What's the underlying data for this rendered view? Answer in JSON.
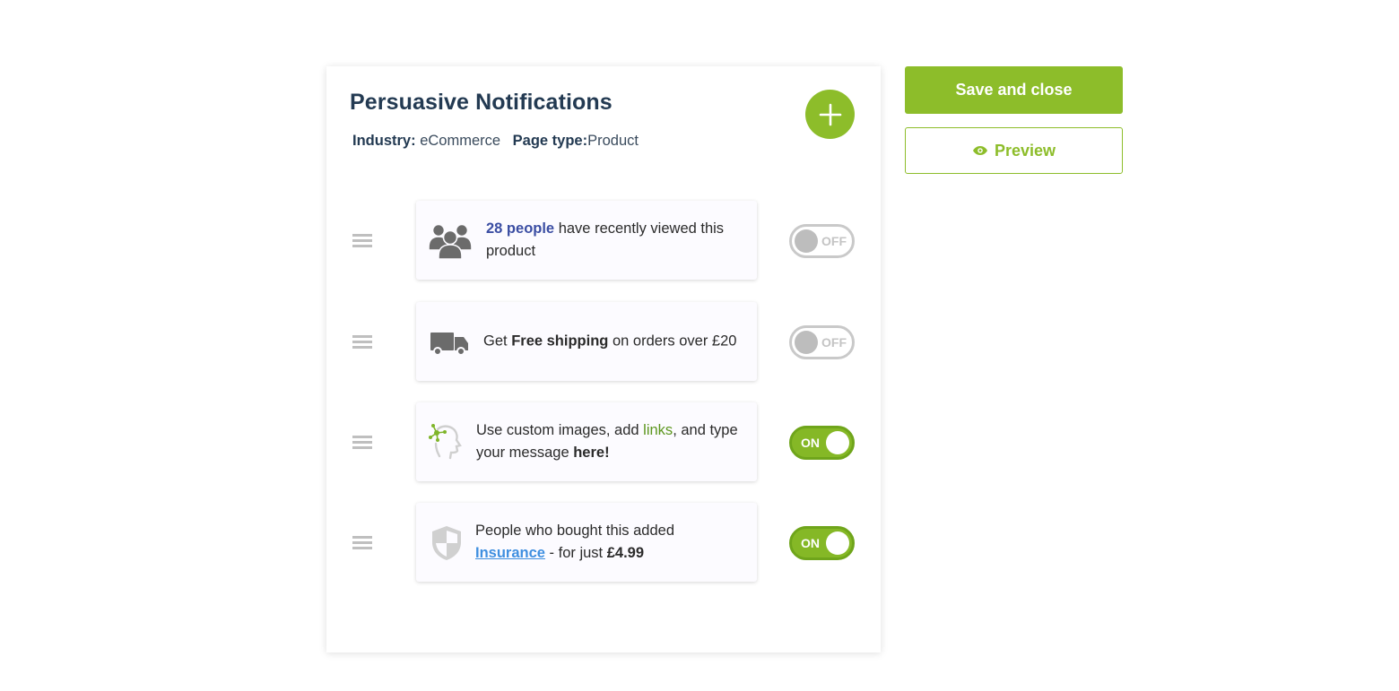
{
  "header": {
    "title": "Persuasive Notifications",
    "industry_label": "Industry:",
    "industry_value": "eCommerce",
    "page_type_label": "Page type:",
    "page_type_value": "Product",
    "add_icon": "plus-icon"
  },
  "actions": {
    "save_label": "Save and close",
    "preview_label": "Preview",
    "preview_icon": "eye-icon"
  },
  "colors": {
    "accent": "#8dbd2a",
    "title": "#233a52",
    "highlight_blue": "#3b4ea3",
    "link_blue": "#3f8fe0"
  },
  "notifications": [
    {
      "icon": "people-group-icon",
      "parts": {
        "a": "28 people",
        "b": " have recently viewed this product"
      },
      "toggle": {
        "state": "off",
        "label": "OFF"
      }
    },
    {
      "icon": "delivery-truck-icon",
      "parts": {
        "a": "Get ",
        "b": "Free shipping",
        "c": " on orders over £20"
      },
      "toggle": {
        "state": "off",
        "label": "OFF"
      }
    },
    {
      "icon": "custom-head-network-icon",
      "parts": {
        "a": "Use custom images, add ",
        "b": "links",
        "c": ", and type your message ",
        "d": "here!"
      },
      "toggle": {
        "state": "on",
        "label": "ON"
      }
    },
    {
      "icon": "shield-icon",
      "parts": {
        "a": "People who bought this added ",
        "b": "Insurance",
        "c": " - for just ",
        "d": "£4.99"
      },
      "toggle": {
        "state": "on",
        "label": "ON"
      }
    }
  ]
}
